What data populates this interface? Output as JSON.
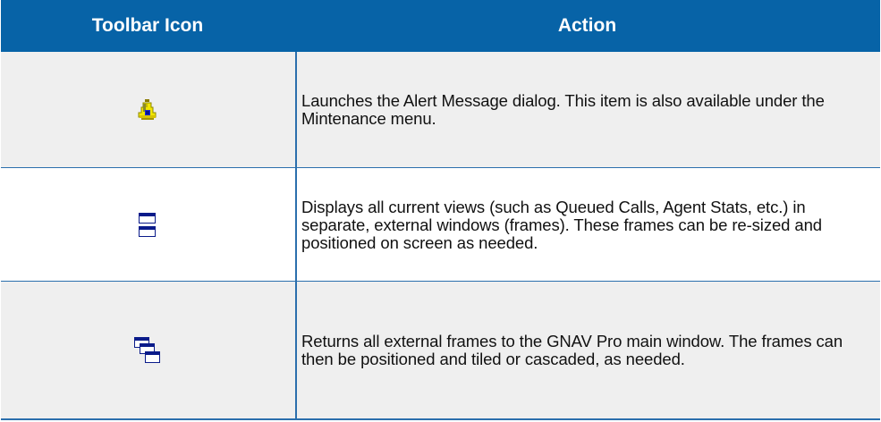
{
  "header": {
    "col_icon": "Toolbar Icon",
    "col_action": "Action"
  },
  "rows": [
    {
      "icon": "alert-bell-icon",
      "action": "Launches the Alert Message dialog. This item is also available under the Mintenance menu."
    },
    {
      "icon": "undock-frames-icon",
      "action": "Displays all current views (such as Queued Calls, Agent Stats, etc.) in separate, external windows (frames). These frames can be re-sized and positioned on screen as needed."
    },
    {
      "icon": "dock-frames-icon",
      "action": "Returns all external frames to the GNAV Pro main window. The frames can then be positioned and tiled or cascaded, as needed."
    }
  ],
  "colors": {
    "header_bg": "#0763a7",
    "header_text": "#ffffff",
    "row_alt_bg": "#efefef",
    "rule": "#2b6fad"
  }
}
